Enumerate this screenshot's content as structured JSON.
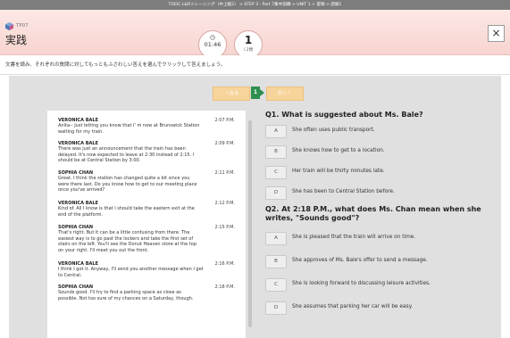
{
  "window": {
    "breadcrumb": "TOEIC L&Rトレーニング（中上級2） > STEP 3 : Part 7集中訓練 > UNIT 1 > 冒頭 > 読解1"
  },
  "header": {
    "tp_label": "TP07",
    "title": "実践",
    "timer": "01:46",
    "question_number": "1",
    "question_total": "/ 2問",
    "close_label": "×"
  },
  "instruction": "文書を読み、それぞれの質問に対してもっともふさわしい答えを選んでクリックして答えましょう。",
  "nav": {
    "prev_label": "〈 戻る",
    "page_indicator": "1",
    "next_label": "次へ 〉"
  },
  "passage": {
    "messages": [
      {
        "name": "VERONICA BALE",
        "time": "2:07 P.M.",
        "text": "Anita-- Just letting you know that I' m now at Brunswick Station\nwaiting for my train."
      },
      {
        "name": "VERONICA BALE",
        "time": "2:09 P.M.",
        "text": "There was just an announcement that the train has been\ndelayed. It's now expected to leave at 2:30 instead of 2:15. I\nshould be at Central Station by 3:00."
      },
      {
        "name": "SOPHIA CHAN",
        "time": "2:11 P.M.",
        "text": "Great. I think the station has changed quite a bit since you\nwere there last. Do you know how to get to our meeting place\nonce you've arrived?"
      },
      {
        "name": "VERONICA BALE",
        "time": "2:12 P.M.",
        "text": "Kind of. All I know is that I should take the eastern exit at the\nend of the platform."
      },
      {
        "name": "SOPHIA CHAN",
        "time": "2:15 P.M.",
        "text": "That's right. But it can be a little confusing from there. The\neasiest way is to go past the lockers and take the first set of\nstairs on the left. You'll see the Donut Heaven store at the top\non your right. I'll meet you out the front."
      },
      {
        "name": "VERONICA BALE",
        "time": "2:16 P.M.",
        "text": "I think I got it. Anyway, I'll send you another message when I get\nto Central."
      },
      {
        "name": "SOPHIA CHAN",
        "time": "2:18 P.M.",
        "text": "Sounds good. I'll try to find a parking space as close as\npossible. Not too sure of my chances on a Saturday, though."
      }
    ]
  },
  "questions": [
    {
      "text": "Q1. What is suggested about Ms. Bale?",
      "options": [
        {
          "letter": "A",
          "text": "She often uses public transport."
        },
        {
          "letter": "B",
          "text": "She knows how to get to a location."
        },
        {
          "letter": "C",
          "text": "Her train will be thirty minutes late."
        },
        {
          "letter": "D",
          "text": "She has been to Central Station before."
        }
      ]
    },
    {
      "text": "Q2. At 2:18 P.M., what does Ms. Chan mean when she writes, \"Sounds good\"?",
      "options": [
        {
          "letter": "A",
          "text": "She is pleased that the train will arrive on time."
        },
        {
          "letter": "B",
          "text": "She approves of Ms. Bale's offer to send a message."
        },
        {
          "letter": "C",
          "text": "She is looking forward to discussing leisure activities."
        },
        {
          "letter": "D",
          "text": "She assumes that parking her car will be easy."
        }
      ]
    }
  ]
}
